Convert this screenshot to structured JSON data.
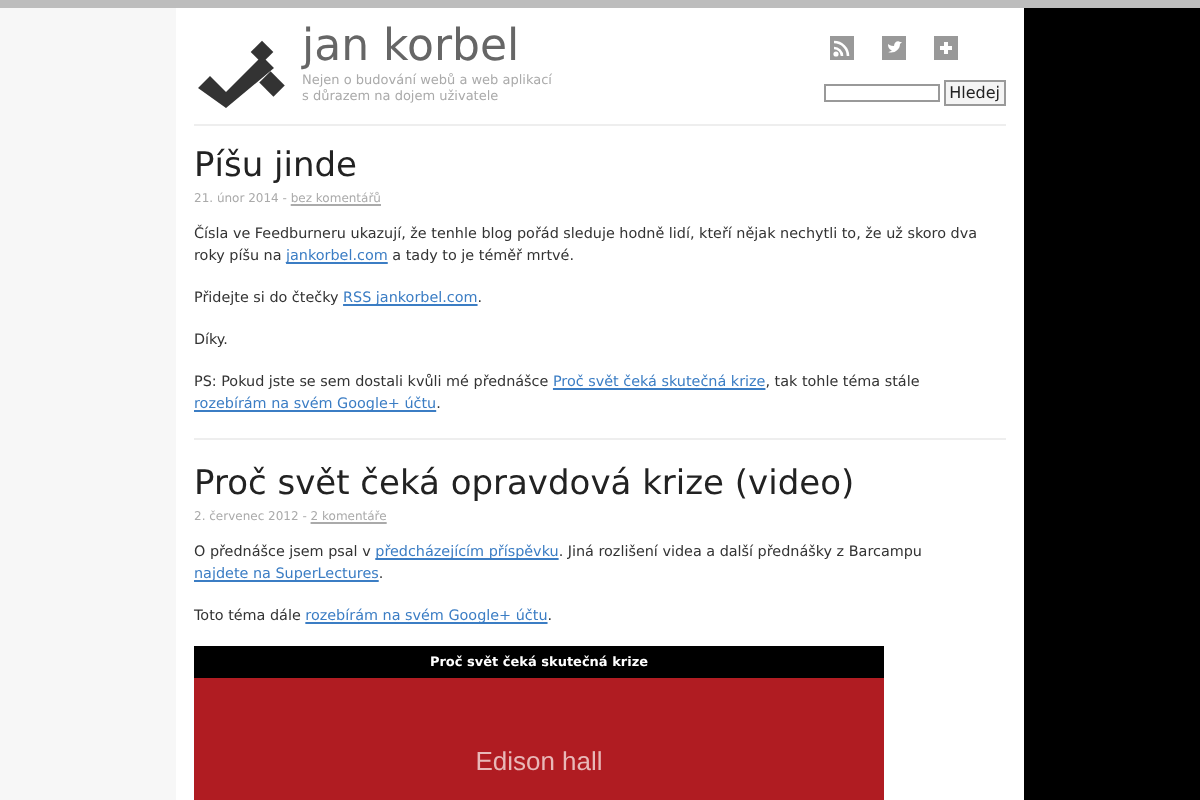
{
  "header": {
    "site_title": "jan korbel",
    "tagline": [
      "Nejen o budování webů a web aplikací",
      "s důrazem na dojem uživatele"
    ],
    "search_button": "Hledej"
  },
  "posts": [
    {
      "title": "Píšu jinde",
      "date": "21. únor 2014 - ",
      "comments": "bez komentářů",
      "paragraphs": [
        [
          {
            "kind": "text",
            "text": "Čísla ve Feedburneru ukazují, že tenhle blog pořád sleduje hodně lidí, kteří nějak nechytli to, že už skoro dva roky píšu na "
          },
          {
            "kind": "link",
            "text": "jankorbel.com"
          },
          {
            "kind": "text",
            "text": " a tady to je téměř mrtvé."
          }
        ],
        [
          {
            "kind": "text",
            "text": "Přidejte si do čtečky "
          },
          {
            "kind": "link",
            "text": "RSS jankorbel.com"
          },
          {
            "kind": "text",
            "text": "."
          }
        ],
        [
          {
            "kind": "text",
            "text": "Díky."
          }
        ],
        [
          {
            "kind": "text",
            "text": "PS: Pokud jste se sem dostali kvůli mé přednášce "
          },
          {
            "kind": "link",
            "text": "Proč svět čeká skutečná krize"
          },
          {
            "kind": "text",
            "text": ", tak tohle téma stále "
          },
          {
            "kind": "link",
            "text": "rozebírám na svém Google+ účtu"
          },
          {
            "kind": "text",
            "text": "."
          }
        ]
      ]
    },
    {
      "title": "Proč svět čeká opravdová krize (video)",
      "date": "2. červenec 2012 - ",
      "comments": "2 komentáře",
      "paragraphs": [
        [
          {
            "kind": "text",
            "text": "O přednášce jsem psal v "
          },
          {
            "kind": "link",
            "text": "předcházejícím příspěvku"
          },
          {
            "kind": "text",
            "text": ". Jiná rozlišení videa a další přednášky z Barcampu "
          },
          {
            "kind": "link",
            "text": "najdete na SuperLectures"
          },
          {
            "kind": "text",
            "text": "."
          }
        ],
        [
          {
            "kind": "text",
            "text": "Toto téma dále "
          },
          {
            "kind": "link",
            "text": "rozebírám na svém Google+ účtu"
          },
          {
            "kind": "text",
            "text": "."
          }
        ]
      ],
      "video": {
        "title": "Proč svět čeká skutečná krize",
        "slide_text": "Edison hall"
      }
    }
  ]
}
